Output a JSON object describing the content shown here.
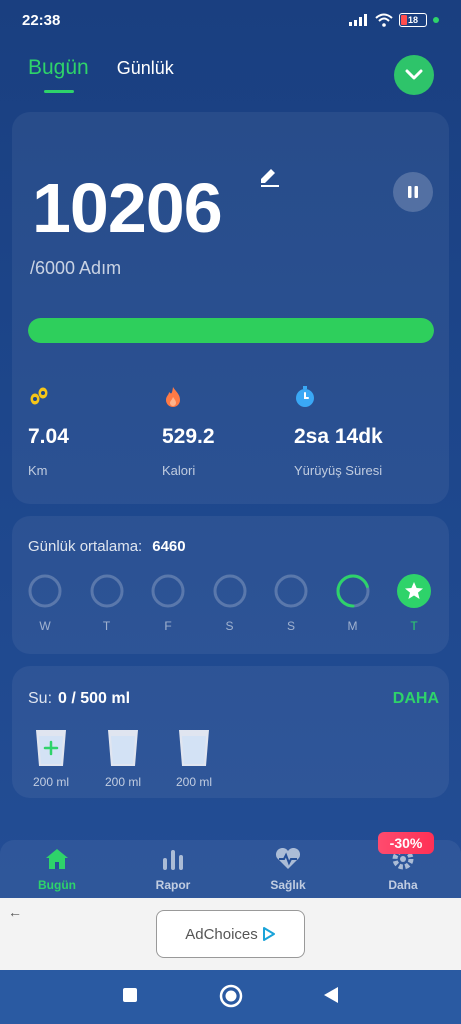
{
  "status": {
    "time": "22:38",
    "battery": "18"
  },
  "tabs": [
    {
      "label": "Bugün"
    },
    {
      "label": "Günlük"
    }
  ],
  "summary": {
    "steps": "10206",
    "goal": "/6000 Adım",
    "progress_fraction": 1.0,
    "metrics": [
      {
        "value": "7.04",
        "label": "Km",
        "icon": "footsteps-icon",
        "color": "#f5c518"
      },
      {
        "value": "529.2",
        "label": "Kalori",
        "icon": "flame-icon",
        "color": "#ff7a45"
      },
      {
        "value": "2sa 14dk",
        "label": "Yürüyüş Süresi",
        "icon": "timer-icon",
        "color": "#3aa8f5"
      }
    ]
  },
  "weekly": {
    "avg_label": "Günlük ortalama:",
    "avg_value": "6460",
    "days": [
      {
        "label": "W",
        "fraction": 0
      },
      {
        "label": "T",
        "fraction": 0
      },
      {
        "label": "F",
        "fraction": 0
      },
      {
        "label": "S",
        "fraction": 0
      },
      {
        "label": "S",
        "fraction": 0
      },
      {
        "label": "M",
        "fraction": 0.7
      },
      {
        "label": "T",
        "fraction": 1,
        "today": true
      }
    ]
  },
  "water": {
    "label": "Su:",
    "value": "0 / 500 ml",
    "more": "DAHA",
    "glasses": [
      {
        "label": "200 ml"
      },
      {
        "label": "200 ml"
      },
      {
        "label": "200 ml"
      }
    ]
  },
  "nav": [
    {
      "label": "Bugün",
      "icon": "home-icon"
    },
    {
      "label": "Rapor",
      "icon": "bar-chart-icon"
    },
    {
      "label": "Sağlık",
      "icon": "heart-pulse-icon"
    },
    {
      "label": "Daha",
      "icon": "gear-icon"
    }
  ],
  "promo": "-30%",
  "ad": {
    "label": "AdChoices"
  },
  "colors": {
    "accent": "#2ed36a",
    "progress": "#2ecf5c"
  }
}
